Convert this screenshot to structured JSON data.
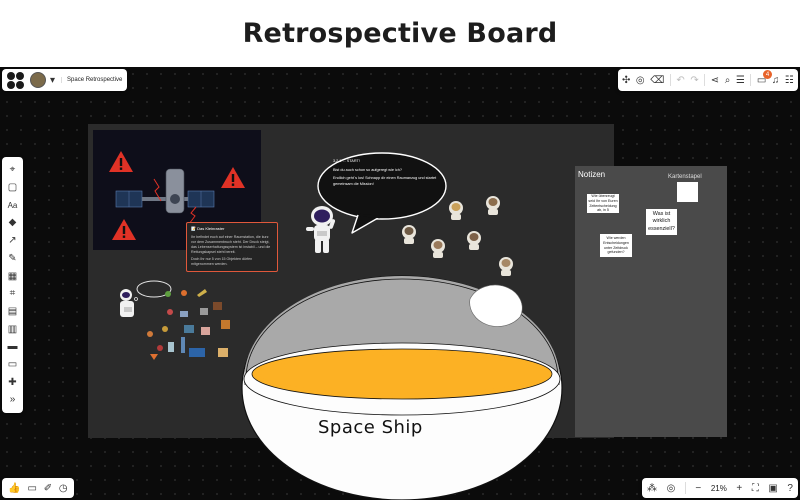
{
  "page": {
    "title": "Retrospective Board"
  },
  "topbar": {
    "board_name": "Space Retrospective",
    "notification_count": "4"
  },
  "bottombar": {
    "zoom": "21%"
  },
  "task_card": {
    "title": "📝 Das Kleinraster",
    "paragraph1": "Ihr befindet euch auf einer Raumstation, die kurz vor dem Zusammenbruch steht. Der Druck steigt, das Lebenserhaltungssystem ist instabil – und die Rettungskapsel steht bereit.",
    "paragraph2": "Doch Ihr nur 5 von 15 Objekten dürfen mitgenommen werden."
  },
  "speech_bubble": {
    "line1": "3,2,1 ... START!",
    "line2": "Bist du auch schon so aufgeregt wie ich?",
    "line3": "Endlich geht´s los! Schnapp dir einen Raumanzug und startet gemeinsam die Mission!"
  },
  "notes_frame": {
    "title": "Notizen",
    "card_stack_title": "Kartenstapel",
    "notes": [
      "Wie überzeugt seid Ihr von Euren Zeitentscheidung ab, in 5",
      "",
      "Was ist wirklich essenziell?",
      "Wie werden Entscheidungen unter Zeitdruck gefunden?"
    ]
  },
  "spaceship": {
    "label": "Space Ship"
  },
  "colors": {
    "canvas": "#0b0b0b",
    "frame": "#2b2b2b",
    "notes_frame": "#4a4a4a",
    "accent": "#e8632a",
    "warning": "#e03226",
    "bowl_fill": "#fcb124"
  },
  "left_tools": [
    "select-icon",
    "sticky-note-icon",
    "text-icon",
    "shapes-icon",
    "connector-icon",
    "pen-icon",
    "table-icon",
    "frame-icon",
    "image-icon",
    "template-icon",
    "comment-icon",
    "card-icon",
    "puzzle-icon",
    "more-icon"
  ]
}
